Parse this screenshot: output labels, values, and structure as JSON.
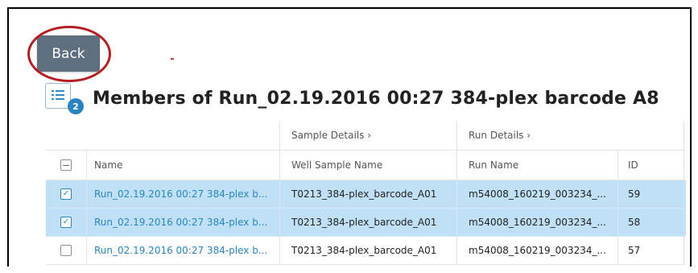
{
  "back_button": {
    "label": "Back"
  },
  "badge": {
    "count": "2"
  },
  "page": {
    "title": "Members of Run_02.19.2016 00:27 384-plex barcode A8"
  },
  "table": {
    "groups": [
      {
        "label": "Sample Details  ›"
      },
      {
        "label": "Run Details  ›"
      }
    ],
    "columns": [
      "Name",
      "Well Sample Name",
      "Run Name",
      "ID"
    ],
    "rows": [
      {
        "name": "Run_02.19.2016 00:27 384-plex b...",
        "well": "T0213_384-plex_barcode_A01",
        "run": "m54008_160219_003234_...",
        "id": "59",
        "selected": true
      },
      {
        "name": "Run_02.19.2016 00:27 384-plex b...",
        "well": "T0213_384-plex_barcode_A01",
        "run": "m54008_160219_003234_...",
        "id": "58",
        "selected": true
      },
      {
        "name": "Run_02.19.2016 00:27 384-plex b...",
        "well": "T0213_384-plex_barcode_A01",
        "run": "m54008_160219_003234_...",
        "id": "57",
        "selected": false
      }
    ]
  },
  "colors": {
    "link": "#2a86c2",
    "selected_row": "#bfe0f6",
    "back_button": "#5f6f80",
    "annotation": "#b41f24",
    "badge": "#2b84be"
  },
  "icons": [
    "list-icon",
    "checkbox-icon",
    "chevron-right-icon"
  ]
}
